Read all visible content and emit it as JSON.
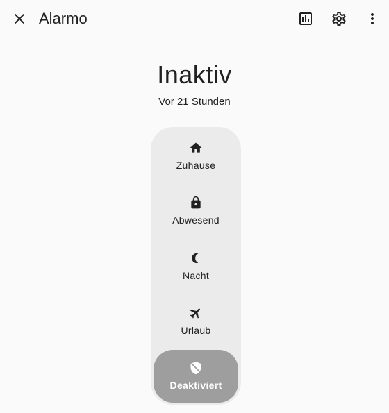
{
  "header": {
    "title": "Alarmo",
    "icons": {
      "close": "close-icon",
      "history": "chart-bar-icon",
      "settings": "gear-icon",
      "more": "dots-vertical-icon"
    }
  },
  "state": {
    "title": "Inaktiv",
    "subtitle": "Vor 21 Stunden"
  },
  "modes": [
    {
      "label": "Zuhause",
      "icon": "home-icon",
      "selected": false
    },
    {
      "label": "Abwesend",
      "icon": "lock-icon",
      "selected": false
    },
    {
      "label": "Nacht",
      "icon": "moon-icon",
      "selected": false
    },
    {
      "label": "Urlaub",
      "icon": "airplane-icon",
      "selected": false
    },
    {
      "label": "Deaktiviert",
      "icon": "shield-off-icon",
      "selected": true
    }
  ],
  "colors": {
    "background": "#fafafa",
    "control_background": "#ebebeb",
    "selected_background": "#9e9e9e",
    "text": "#212121"
  }
}
